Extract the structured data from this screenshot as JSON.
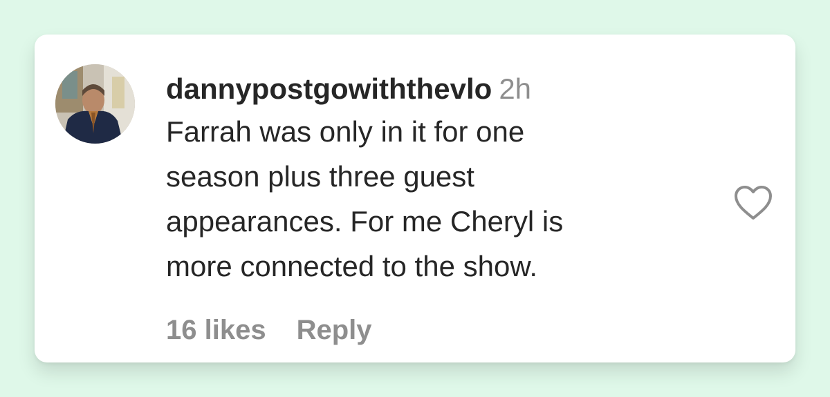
{
  "comment": {
    "username": "dannypostgowiththevlo",
    "time_ago": "2h",
    "text_lines": [
      "Farrah was only in it for one",
      "season plus three guest",
      "appearances. For me Cheryl is",
      "more connected to the show."
    ],
    "likes_label": "16 likes",
    "reply_label": "Reply"
  },
  "icons": {
    "avatar": "user-avatar",
    "like": "heart-outline-icon"
  },
  "colors": {
    "background": "#dff8e9",
    "card": "#ffffff",
    "text_primary": "#262626",
    "text_secondary": "#8e8e8e"
  }
}
